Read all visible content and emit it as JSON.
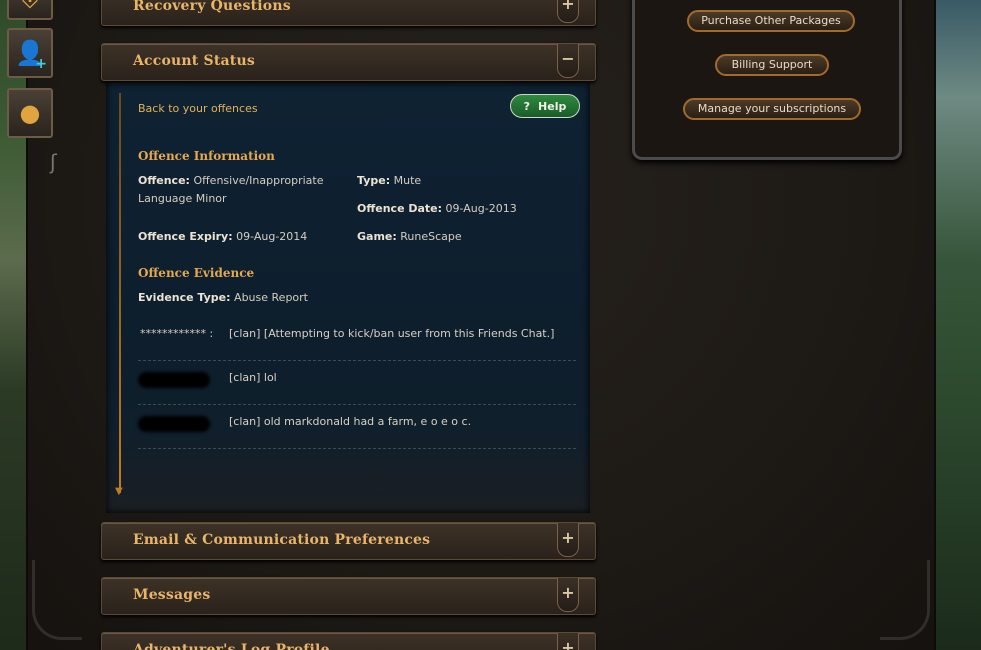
{
  "accordions": {
    "recovery": {
      "title": "Recovery Questions",
      "toggle": "+"
    },
    "status": {
      "title": "Account Status",
      "toggle": "−"
    },
    "email": {
      "title": "Email & Communication Preferences",
      "toggle": "+"
    },
    "messages": {
      "title": "Messages",
      "toggle": "+"
    },
    "adventurer": {
      "title": "Adventurer's Log Profile",
      "toggle": "+"
    }
  },
  "status_panel": {
    "back_link": "Back to your offences",
    "help_label": "Help",
    "help_icon": "?",
    "info_heading": "Offence Information",
    "offence": {
      "label": "Offence:",
      "value": "Offensive/Inappropriate Language Minor"
    },
    "type": {
      "label": "Type:",
      "value": "Mute"
    },
    "date": {
      "label": "Offence Date:",
      "value": "09-Aug-2013"
    },
    "expiry": {
      "label": "Offence Expiry:",
      "value": "09-Aug-2014"
    },
    "game": {
      "label": "Game:",
      "value": "RuneScape"
    },
    "evidence_heading": "Offence Evidence",
    "evidence_type": {
      "label": "Evidence Type:",
      "value": "Abuse Report"
    },
    "chat": [
      {
        "name": "************ :",
        "msg": "[clan] [Attempting to kick/ban user from this Friends Chat.]"
      },
      {
        "name": "",
        "msg": "[clan] lol"
      },
      {
        "name": "",
        "msg": "[clan] old markdonald had a farm, e o e o c."
      }
    ]
  },
  "packages": {
    "purchase": "Purchase Other Packages",
    "billing": "Billing Support",
    "manage": "Manage your subscriptions"
  },
  "colors": {
    "accent_gold": "#e9b56a",
    "panel_blue": "#0f2233",
    "help_green": "#2e8a3f"
  },
  "icons": [
    "shield-icon",
    "add-friend-icon",
    "bomb-icon"
  ]
}
